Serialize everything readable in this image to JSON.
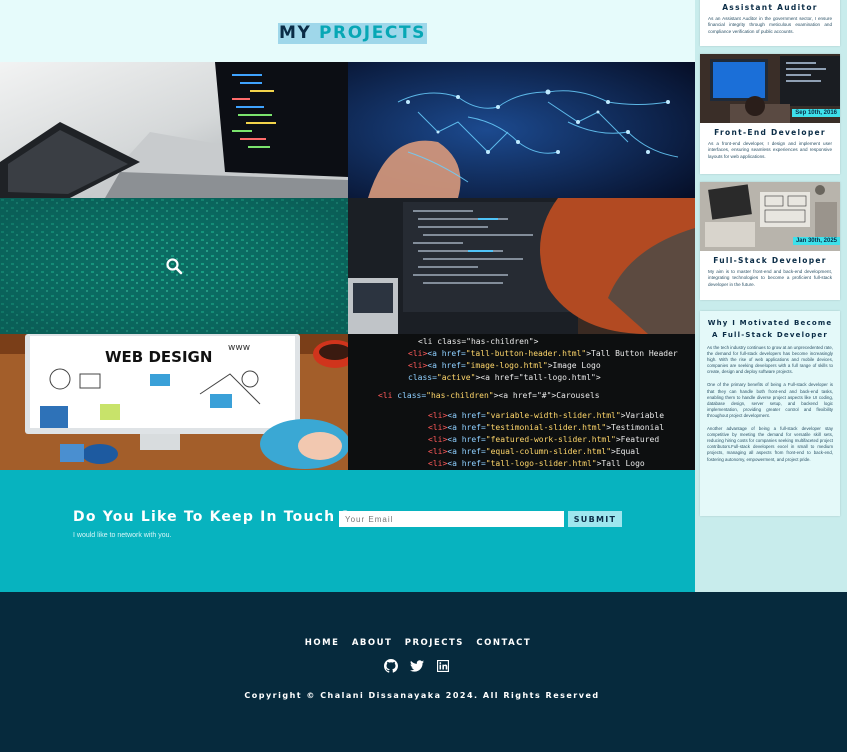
{
  "projects": {
    "title_prefix": "MY",
    "title_main": "PROJECTS",
    "tiles": [
      {
        "subject": "laptop with code on screen"
      },
      {
        "subject": "glowing world map network"
      },
      {
        "subject": "green matrix code",
        "icon": "search-icon"
      },
      {
        "subject": "developer at monitor with code"
      },
      {
        "subject": "web design monitor on desk"
      },
      {
        "subject": "html code closeup"
      }
    ]
  },
  "contact": {
    "title": "Do You Like To Keep In Touch ?",
    "subtitle": "I would like to network with you.",
    "email_placeholder": "Your Email",
    "submit_label": "SUBMIT"
  },
  "sidebar": {
    "cards": [
      {
        "title": "Assistant Auditor",
        "date": "",
        "text": "As an Assistant Auditor in the government sector, I ensure financial integrity through meticulous examination and compliance verification of public accounts."
      },
      {
        "title": "Front-End Developer",
        "date": "Sep 10th, 2016",
        "text": "As a front-end developer, I design and implement user interfaces, ensuring seamless experiences and responsive layouts for web applications."
      },
      {
        "title": "Full-Stack Developer",
        "date": "Jan 30th, 2025",
        "text": "My aim is to master front-end and back-end development, integrating technologies to become a proficient full-stack developer in the future."
      }
    ],
    "why": {
      "title_line1": "Why I Motivated Become",
      "title_line2": "A Full-Stack Developer",
      "paragraphs": [
        "As the tech industry continues to grow at an unprecedented rate, the demand for full-stack developers has become increasingly high. With the rise of web applications and mobile devices, companies are seeking developers with a full range of skills to create, design and deploy software projects.",
        "One of the primary benefits of being a Full-stack developer is that they can handle both front-end and back-end tasks, enabling them to handle diverse project aspects like UI coding, database design, server setup, and backend logic implementation, providing greater control and flexibility throughout project development.",
        "Another advantage of being a full-stack developer stay competitive by meeting the demand for versatile skill sets, reducing hiring costs for companies seeking multifaceted project contributors.Full-stack developers excel in small to medium projects, managing all aspects from front-end to back-end, fostering autonomy, empowerment, and project pride."
      ]
    }
  },
  "footer": {
    "nav": [
      "HOME",
      "ABOUT",
      "PROJECTS",
      "CONTACT"
    ],
    "socials": [
      "github-icon",
      "twitter-icon",
      "linkedin-icon"
    ],
    "copyright": "Copyright © Chalani Dissanayaka 2024. All Rights Reserved"
  },
  "colors": {
    "header_bg": "#e6fbfb",
    "accent_teal": "#07b3bf",
    "navy": "#062a3d",
    "sidebar_bg": "#c8ecec",
    "date_badge": "#3ee0ea"
  }
}
